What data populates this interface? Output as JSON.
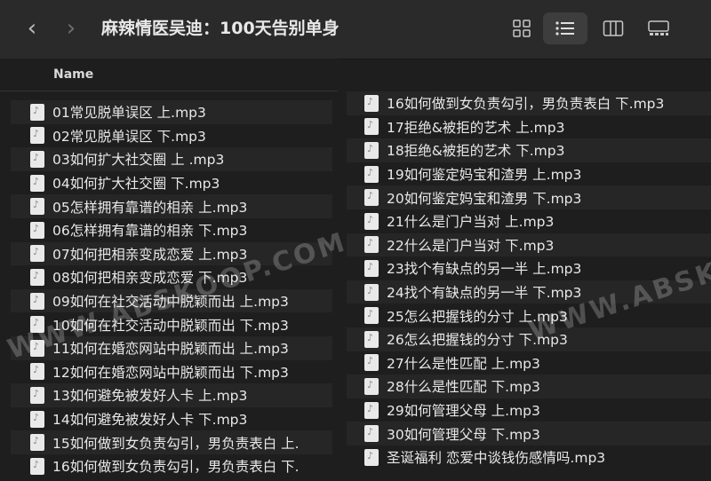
{
  "window": {
    "title": "麻辣情医吴迪：100天告别单身",
    "back_glyph": "‹",
    "forward_glyph": "›"
  },
  "column_header": {
    "name": "Name"
  },
  "files_left": [
    "01常见脱单误区 上.mp3",
    "02常见脱单误区 下.mp3",
    "03如何扩大社交圈 上 .mp3",
    "04如何扩大社交圈 下.mp3",
    "05怎样拥有靠谱的相亲 上.mp3",
    "06怎样拥有靠谱的相亲 下.mp3",
    "07如何把相亲变成恋爱 上.mp3",
    "08如何把相亲变成恋爱 下.mp3",
    "09如何在社交活动中脱颖而出 上.mp3",
    "10如何在社交活动中脱颖而出 下.mp3",
    "11如何在婚恋网站中脱颖而出 上.mp3",
    "12如何在婚恋网站中脱颖而出 下.mp3",
    "13如何避免被发好人卡 上.mp3",
    "14如何避免被发好人卡 下.mp3",
    "15如何做到女负责勾引，男负责表白 上.",
    "16如何做到女负责勾引，男负责表白 下."
  ],
  "files_right": [
    "16如何做到女负责勾引，男负责表白 下.mp3",
    "17拒绝&被拒的艺术 上.mp3",
    "18拒绝&被拒的艺术 下.mp3",
    "19如何鉴定妈宝和渣男 上.mp3",
    "20如何鉴定妈宝和渣男 下.mp3",
    "21什么是门户当对 上.mp3",
    "22什么是门户当对 下.mp3",
    "23找个有缺点的另一半 上.mp3",
    "24找个有缺点的另一半 下.mp3",
    "25怎么把握钱的分寸 上.mp3",
    "26怎么把握钱的分寸 下.mp3",
    "27什么是性匹配 上.mp3",
    "28什么是性匹配 下.mp3",
    "29如何管理父母 上.mp3",
    "30如何管理父母 下.mp3",
    "圣诞福利 恋爱中谈钱伤感情吗.mp3"
  ],
  "watermarks": [
    "WWW.ABSKOOP.COM",
    "WWW.ABSKO"
  ],
  "colors": {
    "background": "#1e1e1e",
    "toolbar": "#2a2a2a",
    "active_view": "#3d3d3d"
  }
}
